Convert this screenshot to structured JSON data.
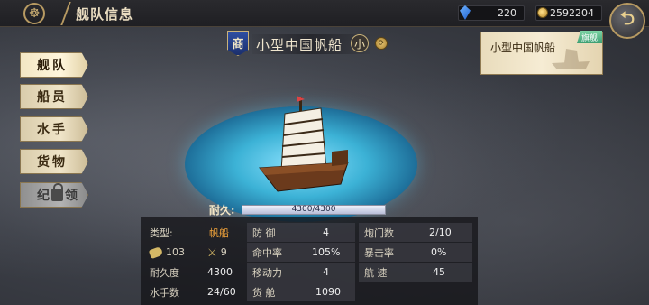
{
  "header": {
    "title": "舰队信息",
    "gems": "220",
    "coins": "2592204",
    "back_icon": "back-arrow-icon"
  },
  "sidebar": {
    "tabs": [
      {
        "label": "舰队",
        "state": "active"
      },
      {
        "label": "船员",
        "state": "normal"
      },
      {
        "label": "水手",
        "state": "normal"
      },
      {
        "label": "货物",
        "state": "normal"
      },
      {
        "label_left": "纪",
        "label_right": "领",
        "state": "locked"
      }
    ]
  },
  "ship": {
    "faction": "商",
    "name": "小型中国帆船",
    "size": "小",
    "durability_label": "耐久:",
    "durability_text": "4300/4300",
    "durability_fraction": 1.0
  },
  "stats": {
    "type_label": "类型:",
    "type_value": "帆船",
    "cannon_value": "103",
    "melee_value": "9",
    "durability_label": "耐久度",
    "durability_value": "4300",
    "sailors_label": "水手数",
    "sailors_value": "24/60",
    "defense_label": "防 御",
    "defense_value": "4",
    "accuracy_label": "命中率",
    "accuracy_value": "105%",
    "move_label": "移动力",
    "move_value": "4",
    "cargo_label": "货 舱",
    "cargo_value": "1090",
    "ports_label": "炮门数",
    "ports_value": "2/10",
    "crit_label": "暴击率",
    "crit_value": "0%",
    "speed_label": "航 速",
    "speed_value": "45"
  },
  "fleet_card": {
    "name": "小型中国帆船",
    "tag": "旗舰"
  },
  "colors": {
    "accent_gold": "#b79a62",
    "value_orange": "#f0a23a",
    "water": "#3cb2d6"
  }
}
